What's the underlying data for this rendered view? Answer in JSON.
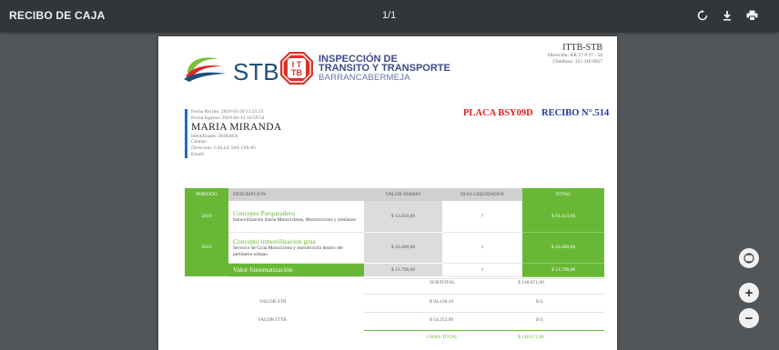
{
  "toolbar": {
    "title": "RECIBO DE CAJA",
    "page_indicator": "1/1"
  },
  "header": {
    "stb_logo_text": "STB",
    "ittb_logo_text": "ITTB",
    "ittb_line1": "INSPECCIÓN DE",
    "ittb_line2": "TRANSITO Y TRANSPORTE",
    "ittb_line3": "BARRANCABERMEJA",
    "company_name": "ITTB-STB",
    "company_address": "Dirección: KR 27 # 27 - 50",
    "company_phone": "(Telefono: 312 318 6927"
  },
  "client": {
    "fecha_recibo": "Fecha Recibo: 2019-03-20 11:21:13",
    "fecha_ingreso": "Fecha Ingreso: 2019-03-14 10:59:54",
    "name": "MARIA MIRANDA",
    "identificado": "Identificado: 28483856",
    "celular": "Celular:",
    "direccion": "Direccion: CALLE 58A 19A-05",
    "email": "Email:"
  },
  "placa": "PLACA BSY09D",
  "recibo": "RECIBO N°.514",
  "table": {
    "headers": [
      "PERIODO",
      "DESCRIPCION",
      "VALOR DIARIO",
      "DIAS LIQUIDADOS",
      "TOTAL"
    ],
    "rows": [
      {
        "periodo": "2019",
        "concepto": "Concepto Parqueadero",
        "detalle": "Inmovilización diaria Motocicletas, Motorriciclos y similares",
        "valor": "$ 13.059,00",
        "dias": "7",
        "total": "$ 91.413,00"
      },
      {
        "periodo": "2019",
        "concepto": "Concepto inmovilizacion grua",
        "detalle": "Servicio de Grúa Motocicleta y mototriciclo dentro del perímetro urbano",
        "valor": "$ 43.460,00",
        "dias": "1",
        "total": "$ 43.460,00"
      },
      {
        "periodo": "",
        "concepto": "Valor Sistematización",
        "detalle": "",
        "valor": "$ 13.798,00",
        "dias": "1",
        "total": "$ 13.798,00"
      }
    ]
  },
  "summary": {
    "subtotal_label": "SUBTOTAL",
    "subtotal_value": "$ 148.671,00",
    "valor_stb_label": "VALOR STB",
    "valor_stb_mid": "$ 94.418,10",
    "valor_stb_value": "$ 0,",
    "valor_ittb_label": "VALOR ITTB",
    "valor_ittb_mid": "$ 54.252,90",
    "valor_ittb_value": "$ 0,",
    "gran_total_label": "GRAN TOTAL",
    "gran_total_value": "$ 148.671,00"
  },
  "colors": {
    "accent_green": "#68b836",
    "placa_red": "#e0201f",
    "recibo_blue": "#1f3aa3",
    "toolbar_bg": "#323639",
    "viewer_bg": "#525659"
  },
  "icons": [
    "rotate-icon",
    "download-icon",
    "print-icon",
    "fit-page-icon",
    "zoom-in-icon",
    "zoom-out-icon"
  ]
}
